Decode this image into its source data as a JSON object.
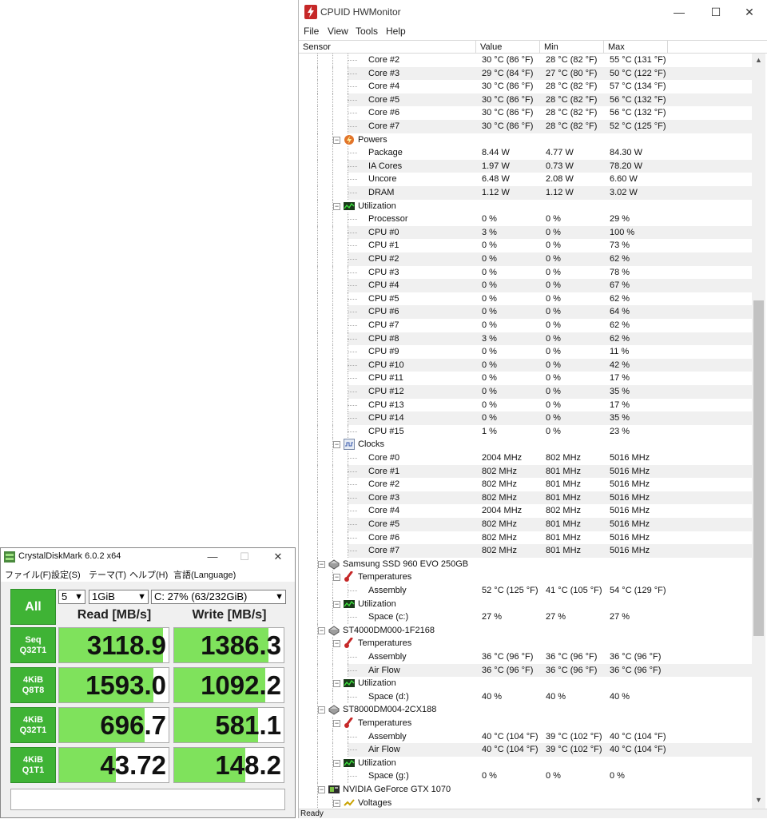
{
  "hwmonitor": {
    "title": "CPUID HWMonitor",
    "window_buttons": [
      "—",
      "☐",
      "✕"
    ],
    "menu": [
      "File",
      "View",
      "Tools",
      "Help"
    ],
    "columns": [
      "Sensor",
      "Value",
      "Min",
      "Max"
    ],
    "status": "Ready",
    "rows": [
      {
        "type": "leaf",
        "indent": 3,
        "label": "Core #2",
        "value": "30 °C  (86 °F)",
        "min": "28 °C  (82 °F)",
        "max": "55 °C  (131 °F)"
      },
      {
        "type": "leaf",
        "indent": 3,
        "label": "Core #3",
        "value": "29 °C  (84 °F)",
        "min": "27 °C  (80 °F)",
        "max": "50 °C  (122 °F)"
      },
      {
        "type": "leaf",
        "indent": 3,
        "label": "Core #4",
        "value": "30 °C  (86 °F)",
        "min": "28 °C  (82 °F)",
        "max": "57 °C  (134 °F)"
      },
      {
        "type": "leaf",
        "indent": 3,
        "label": "Core #5",
        "value": "30 °C  (86 °F)",
        "min": "28 °C  (82 °F)",
        "max": "56 °C  (132 °F)"
      },
      {
        "type": "leaf",
        "indent": 3,
        "label": "Core #6",
        "value": "30 °C  (86 °F)",
        "min": "28 °C  (82 °F)",
        "max": "56 °C  (132 °F)"
      },
      {
        "type": "leaf",
        "indent": 3,
        "label": "Core #7",
        "value": "30 °C  (86 °F)",
        "min": "28 °C  (82 °F)",
        "max": "52 °C  (125 °F)"
      },
      {
        "type": "group",
        "indent": 2,
        "label": "Powers",
        "icon": "power-icon"
      },
      {
        "type": "leaf",
        "indent": 3,
        "label": "Package",
        "value": "8.44 W",
        "min": "4.77 W",
        "max": "84.30 W"
      },
      {
        "type": "leaf",
        "indent": 3,
        "label": "IA Cores",
        "value": "1.97 W",
        "min": "0.73 W",
        "max": "78.20 W"
      },
      {
        "type": "leaf",
        "indent": 3,
        "label": "Uncore",
        "value": "6.48 W",
        "min": "2.08 W",
        "max": "6.60 W"
      },
      {
        "type": "leaf",
        "indent": 3,
        "label": "DRAM",
        "value": "1.12 W",
        "min": "1.12 W",
        "max": "3.02 W"
      },
      {
        "type": "group",
        "indent": 2,
        "label": "Utilization",
        "icon": "utilization-icon"
      },
      {
        "type": "leaf",
        "indent": 3,
        "label": "Processor",
        "value": "0 %",
        "min": "0 %",
        "max": "29 %"
      },
      {
        "type": "leaf",
        "indent": 3,
        "label": "CPU #0",
        "value": "3 %",
        "min": "0 %",
        "max": "100 %"
      },
      {
        "type": "leaf",
        "indent": 3,
        "label": "CPU #1",
        "value": "0 %",
        "min": "0 %",
        "max": "73 %"
      },
      {
        "type": "leaf",
        "indent": 3,
        "label": "CPU #2",
        "value": "0 %",
        "min": "0 %",
        "max": "62 %"
      },
      {
        "type": "leaf",
        "indent": 3,
        "label": "CPU #3",
        "value": "0 %",
        "min": "0 %",
        "max": "78 %"
      },
      {
        "type": "leaf",
        "indent": 3,
        "label": "CPU #4",
        "value": "0 %",
        "min": "0 %",
        "max": "67 %"
      },
      {
        "type": "leaf",
        "indent": 3,
        "label": "CPU #5",
        "value": "0 %",
        "min": "0 %",
        "max": "62 %"
      },
      {
        "type": "leaf",
        "indent": 3,
        "label": "CPU #6",
        "value": "0 %",
        "min": "0 %",
        "max": "64 %"
      },
      {
        "type": "leaf",
        "indent": 3,
        "label": "CPU #7",
        "value": "0 %",
        "min": "0 %",
        "max": "62 %"
      },
      {
        "type": "leaf",
        "indent": 3,
        "label": "CPU #8",
        "value": "3 %",
        "min": "0 %",
        "max": "62 %"
      },
      {
        "type": "leaf",
        "indent": 3,
        "label": "CPU #9",
        "value": "0 %",
        "min": "0 %",
        "max": "11 %"
      },
      {
        "type": "leaf",
        "indent": 3,
        "label": "CPU #10",
        "value": "0 %",
        "min": "0 %",
        "max": "42 %"
      },
      {
        "type": "leaf",
        "indent": 3,
        "label": "CPU #11",
        "value": "0 %",
        "min": "0 %",
        "max": "17 %"
      },
      {
        "type": "leaf",
        "indent": 3,
        "label": "CPU #12",
        "value": "0 %",
        "min": "0 %",
        "max": "35 %"
      },
      {
        "type": "leaf",
        "indent": 3,
        "label": "CPU #13",
        "value": "0 %",
        "min": "0 %",
        "max": "17 %"
      },
      {
        "type": "leaf",
        "indent": 3,
        "label": "CPU #14",
        "value": "0 %",
        "min": "0 %",
        "max": "35 %"
      },
      {
        "type": "leaf",
        "indent": 3,
        "label": "CPU #15",
        "value": "1 %",
        "min": "0 %",
        "max": "23 %"
      },
      {
        "type": "group",
        "indent": 2,
        "label": "Clocks",
        "icon": "clock-wave-icon"
      },
      {
        "type": "leaf",
        "indent": 3,
        "label": "Core #0",
        "value": "2004 MHz",
        "min": "802 MHz",
        "max": "5016 MHz"
      },
      {
        "type": "leaf",
        "indent": 3,
        "label": "Core #1",
        "value": "802 MHz",
        "min": "801 MHz",
        "max": "5016 MHz"
      },
      {
        "type": "leaf",
        "indent": 3,
        "label": "Core #2",
        "value": "802 MHz",
        "min": "801 MHz",
        "max": "5016 MHz"
      },
      {
        "type": "leaf",
        "indent": 3,
        "label": "Core #3",
        "value": "802 MHz",
        "min": "801 MHz",
        "max": "5016 MHz"
      },
      {
        "type": "leaf",
        "indent": 3,
        "label": "Core #4",
        "value": "2004 MHz",
        "min": "802 MHz",
        "max": "5016 MHz"
      },
      {
        "type": "leaf",
        "indent": 3,
        "label": "Core #5",
        "value": "802 MHz",
        "min": "801 MHz",
        "max": "5016 MHz"
      },
      {
        "type": "leaf",
        "indent": 3,
        "label": "Core #6",
        "value": "802 MHz",
        "min": "801 MHz",
        "max": "5016 MHz"
      },
      {
        "type": "leaf",
        "indent": 3,
        "label": "Core #7",
        "value": "802 MHz",
        "min": "801 MHz",
        "max": "5016 MHz"
      },
      {
        "type": "device",
        "indent": 1,
        "label": "Samsung SSD 960 EVO 250GB",
        "icon": "drive-icon"
      },
      {
        "type": "group",
        "indent": 2,
        "label": "Temperatures",
        "icon": "thermometer-icon"
      },
      {
        "type": "leaf",
        "indent": 3,
        "label": "Assembly",
        "value": "52 °C  (125 °F)",
        "min": "41 °C  (105 °F)",
        "max": "54 °C  (129 °F)"
      },
      {
        "type": "group",
        "indent": 2,
        "label": "Utilization",
        "icon": "utilization-icon"
      },
      {
        "type": "leaf",
        "indent": 3,
        "label": "Space (c:)",
        "value": "27 %",
        "min": "27 %",
        "max": "27 %"
      },
      {
        "type": "device",
        "indent": 1,
        "label": "ST4000DM000-1F2168",
        "icon": "drive-icon"
      },
      {
        "type": "group",
        "indent": 2,
        "label": "Temperatures",
        "icon": "thermometer-icon"
      },
      {
        "type": "leaf",
        "indent": 3,
        "label": "Assembly",
        "value": "36 °C  (96 °F)",
        "min": "36 °C  (96 °F)",
        "max": "36 °C  (96 °F)"
      },
      {
        "type": "leaf",
        "indent": 3,
        "label": "Air Flow",
        "value": "36 °C  (96 °F)",
        "min": "36 °C  (96 °F)",
        "max": "36 °C  (96 °F)"
      },
      {
        "type": "group",
        "indent": 2,
        "label": "Utilization",
        "icon": "utilization-icon"
      },
      {
        "type": "leaf",
        "indent": 3,
        "label": "Space (d:)",
        "value": "40 %",
        "min": "40 %",
        "max": "40 %"
      },
      {
        "type": "device",
        "indent": 1,
        "label": "ST8000DM004-2CX188",
        "icon": "drive-icon"
      },
      {
        "type": "group",
        "indent": 2,
        "label": "Temperatures",
        "icon": "thermometer-icon"
      },
      {
        "type": "leaf",
        "indent": 3,
        "label": "Assembly",
        "value": "40 °C  (104 °F)",
        "min": "39 °C  (102 °F)",
        "max": "40 °C  (104 °F)"
      },
      {
        "type": "leaf",
        "indent": 3,
        "label": "Air Flow",
        "value": "40 °C  (104 °F)",
        "min": "39 °C  (102 °F)",
        "max": "40 °C  (104 °F)"
      },
      {
        "type": "group",
        "indent": 2,
        "label": "Utilization",
        "icon": "utilization-icon"
      },
      {
        "type": "leaf",
        "indent": 3,
        "label": "Space (g:)",
        "value": "0 %",
        "min": "0 %",
        "max": "0 %"
      },
      {
        "type": "device",
        "indent": 1,
        "label": "NVIDIA GeForce GTX 1070",
        "icon": "gpu-icon"
      },
      {
        "type": "group",
        "indent": 2,
        "label": "Voltages",
        "icon": "voltage-icon"
      }
    ]
  },
  "cdm": {
    "title": "CrystalDiskMark 6.0.2 x64",
    "window_buttons": [
      "—",
      "☐",
      "✕"
    ],
    "menu": [
      "ファイル(F)",
      "設定(S)",
      "テーマ(T)",
      "ヘルプ(H)",
      "言語(Language)"
    ],
    "all_label": "All",
    "count": "5",
    "size": "1GiB",
    "drive": "C: 27% (63/232GiB)",
    "read_header": "Read [MB/s]",
    "write_header": "Write [MB/s]",
    "tests": [
      {
        "line1": "Seq",
        "line2": "Q32T1",
        "read": "3118.9",
        "write": "1386.3",
        "read_fill": 0.95,
        "write_fill": 0.86
      },
      {
        "line1": "4KiB",
        "line2": "Q8T8",
        "read": "1593.0",
        "write": "1092.2",
        "read_fill": 0.86,
        "write_fill": 0.83
      },
      {
        "line1": "4KiB",
        "line2": "Q32T1",
        "read": "696.7",
        "write": "581.1",
        "read_fill": 0.78,
        "write_fill": 0.77
      },
      {
        "line1": "4KiB",
        "line2": "Q1T1",
        "read": "43.72",
        "write": "148.2",
        "read_fill": 0.52,
        "write_fill": 0.65
      }
    ],
    "comment": ""
  }
}
